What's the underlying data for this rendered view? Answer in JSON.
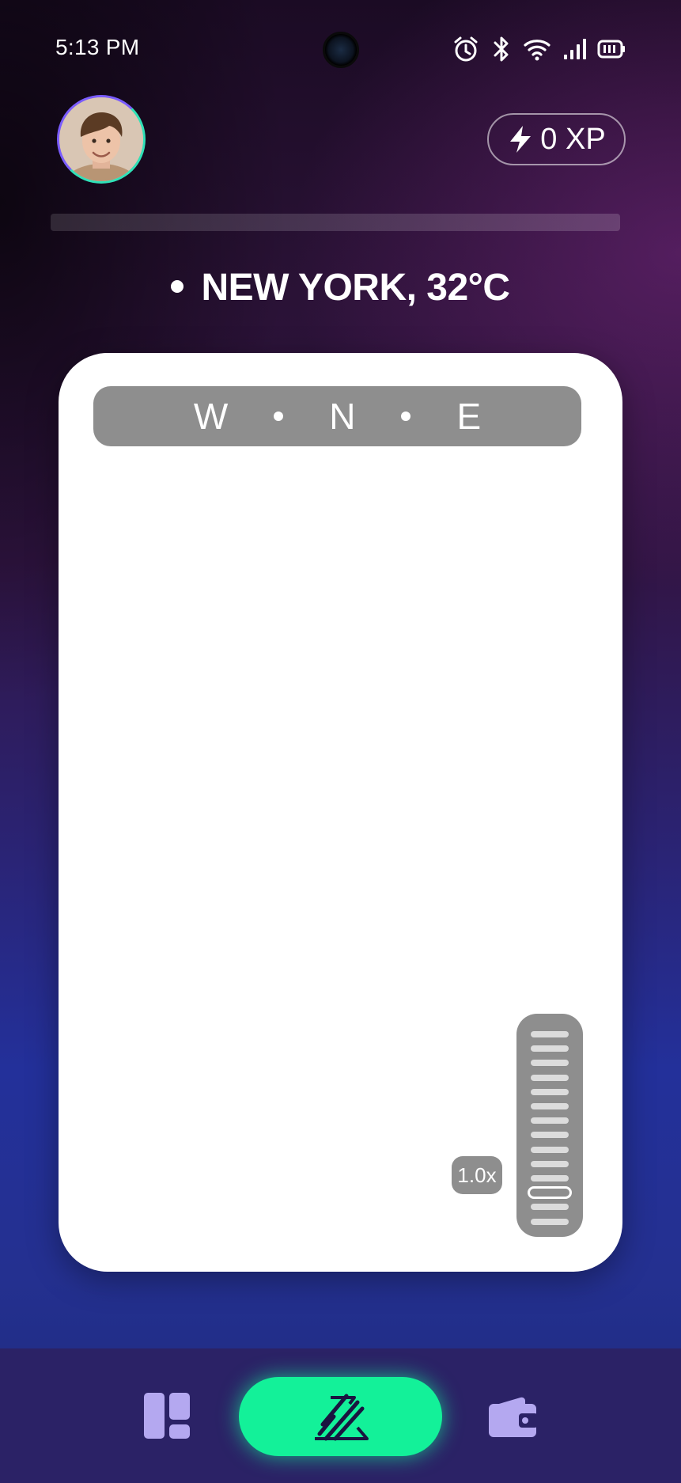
{
  "status_bar": {
    "time": "5:13 PM",
    "icons": [
      "alarm-icon",
      "bluetooth-icon",
      "wifi-icon",
      "signal-icon",
      "battery-icon"
    ]
  },
  "header": {
    "avatar": "profile-avatar",
    "xp": {
      "icon": "lightning-icon",
      "label": "0 XP",
      "progress": 0
    }
  },
  "location": {
    "text": "NEW YORK, 32°C"
  },
  "camera": {
    "compass": {
      "left": "W",
      "center": "N",
      "right": "E"
    },
    "zoom": {
      "label": "1.0x",
      "level": 1.0
    }
  },
  "bottom_nav": {
    "items": [
      "dashboard-icon",
      "capture-icon",
      "wallet-icon"
    ],
    "accent": "#13f199",
    "icon_color": "#b4a8f0"
  }
}
